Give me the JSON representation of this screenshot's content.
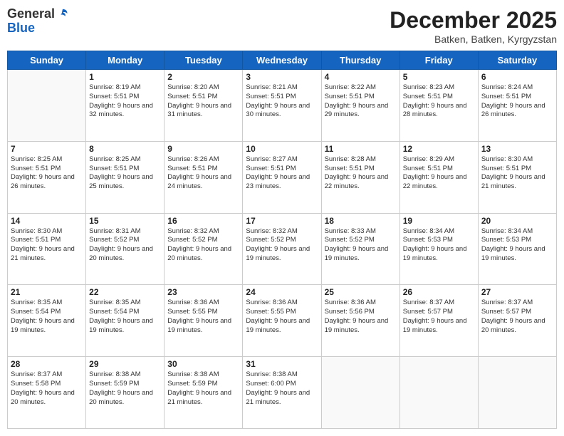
{
  "header": {
    "logo_general": "General",
    "logo_blue": "Blue",
    "month": "December 2025",
    "location": "Batken, Batken, Kyrgyzstan"
  },
  "days_of_week": [
    "Sunday",
    "Monday",
    "Tuesday",
    "Wednesday",
    "Thursday",
    "Friday",
    "Saturday"
  ],
  "weeks": [
    [
      {
        "day": "",
        "sunrise": "",
        "sunset": "",
        "daylight": ""
      },
      {
        "day": "1",
        "sunrise": "Sunrise: 8:19 AM",
        "sunset": "Sunset: 5:51 PM",
        "daylight": "Daylight: 9 hours and 32 minutes."
      },
      {
        "day": "2",
        "sunrise": "Sunrise: 8:20 AM",
        "sunset": "Sunset: 5:51 PM",
        "daylight": "Daylight: 9 hours and 31 minutes."
      },
      {
        "day": "3",
        "sunrise": "Sunrise: 8:21 AM",
        "sunset": "Sunset: 5:51 PM",
        "daylight": "Daylight: 9 hours and 30 minutes."
      },
      {
        "day": "4",
        "sunrise": "Sunrise: 8:22 AM",
        "sunset": "Sunset: 5:51 PM",
        "daylight": "Daylight: 9 hours and 29 minutes."
      },
      {
        "day": "5",
        "sunrise": "Sunrise: 8:23 AM",
        "sunset": "Sunset: 5:51 PM",
        "daylight": "Daylight: 9 hours and 28 minutes."
      },
      {
        "day": "6",
        "sunrise": "Sunrise: 8:24 AM",
        "sunset": "Sunset: 5:51 PM",
        "daylight": "Daylight: 9 hours and 26 minutes."
      }
    ],
    [
      {
        "day": "7",
        "sunrise": "Sunrise: 8:25 AM",
        "sunset": "Sunset: 5:51 PM",
        "daylight": "Daylight: 9 hours and 26 minutes."
      },
      {
        "day": "8",
        "sunrise": "Sunrise: 8:25 AM",
        "sunset": "Sunset: 5:51 PM",
        "daylight": "Daylight: 9 hours and 25 minutes."
      },
      {
        "day": "9",
        "sunrise": "Sunrise: 8:26 AM",
        "sunset": "Sunset: 5:51 PM",
        "daylight": "Daylight: 9 hours and 24 minutes."
      },
      {
        "day": "10",
        "sunrise": "Sunrise: 8:27 AM",
        "sunset": "Sunset: 5:51 PM",
        "daylight": "Daylight: 9 hours and 23 minutes."
      },
      {
        "day": "11",
        "sunrise": "Sunrise: 8:28 AM",
        "sunset": "Sunset: 5:51 PM",
        "daylight": "Daylight: 9 hours and 22 minutes."
      },
      {
        "day": "12",
        "sunrise": "Sunrise: 8:29 AM",
        "sunset": "Sunset: 5:51 PM",
        "daylight": "Daylight: 9 hours and 22 minutes."
      },
      {
        "day": "13",
        "sunrise": "Sunrise: 8:30 AM",
        "sunset": "Sunset: 5:51 PM",
        "daylight": "Daylight: 9 hours and 21 minutes."
      }
    ],
    [
      {
        "day": "14",
        "sunrise": "Sunrise: 8:30 AM",
        "sunset": "Sunset: 5:51 PM",
        "daylight": "Daylight: 9 hours and 21 minutes."
      },
      {
        "day": "15",
        "sunrise": "Sunrise: 8:31 AM",
        "sunset": "Sunset: 5:52 PM",
        "daylight": "Daylight: 9 hours and 20 minutes."
      },
      {
        "day": "16",
        "sunrise": "Sunrise: 8:32 AM",
        "sunset": "Sunset: 5:52 PM",
        "daylight": "Daylight: 9 hours and 20 minutes."
      },
      {
        "day": "17",
        "sunrise": "Sunrise: 8:32 AM",
        "sunset": "Sunset: 5:52 PM",
        "daylight": "Daylight: 9 hours and 19 minutes."
      },
      {
        "day": "18",
        "sunrise": "Sunrise: 8:33 AM",
        "sunset": "Sunset: 5:52 PM",
        "daylight": "Daylight: 9 hours and 19 minutes."
      },
      {
        "day": "19",
        "sunrise": "Sunrise: 8:34 AM",
        "sunset": "Sunset: 5:53 PM",
        "daylight": "Daylight: 9 hours and 19 minutes."
      },
      {
        "day": "20",
        "sunrise": "Sunrise: 8:34 AM",
        "sunset": "Sunset: 5:53 PM",
        "daylight": "Daylight: 9 hours and 19 minutes."
      }
    ],
    [
      {
        "day": "21",
        "sunrise": "Sunrise: 8:35 AM",
        "sunset": "Sunset: 5:54 PM",
        "daylight": "Daylight: 9 hours and 19 minutes."
      },
      {
        "day": "22",
        "sunrise": "Sunrise: 8:35 AM",
        "sunset": "Sunset: 5:54 PM",
        "daylight": "Daylight: 9 hours and 19 minutes."
      },
      {
        "day": "23",
        "sunrise": "Sunrise: 8:36 AM",
        "sunset": "Sunset: 5:55 PM",
        "daylight": "Daylight: 9 hours and 19 minutes."
      },
      {
        "day": "24",
        "sunrise": "Sunrise: 8:36 AM",
        "sunset": "Sunset: 5:55 PM",
        "daylight": "Daylight: 9 hours and 19 minutes."
      },
      {
        "day": "25",
        "sunrise": "Sunrise: 8:36 AM",
        "sunset": "Sunset: 5:56 PM",
        "daylight": "Daylight: 9 hours and 19 minutes."
      },
      {
        "day": "26",
        "sunrise": "Sunrise: 8:37 AM",
        "sunset": "Sunset: 5:57 PM",
        "daylight": "Daylight: 9 hours and 19 minutes."
      },
      {
        "day": "27",
        "sunrise": "Sunrise: 8:37 AM",
        "sunset": "Sunset: 5:57 PM",
        "daylight": "Daylight: 9 hours and 20 minutes."
      }
    ],
    [
      {
        "day": "28",
        "sunrise": "Sunrise: 8:37 AM",
        "sunset": "Sunset: 5:58 PM",
        "daylight": "Daylight: 9 hours and 20 minutes."
      },
      {
        "day": "29",
        "sunrise": "Sunrise: 8:38 AM",
        "sunset": "Sunset: 5:59 PM",
        "daylight": "Daylight: 9 hours and 20 minutes."
      },
      {
        "day": "30",
        "sunrise": "Sunrise: 8:38 AM",
        "sunset": "Sunset: 5:59 PM",
        "daylight": "Daylight: 9 hours and 21 minutes."
      },
      {
        "day": "31",
        "sunrise": "Sunrise: 8:38 AM",
        "sunset": "Sunset: 6:00 PM",
        "daylight": "Daylight: 9 hours and 21 minutes."
      },
      {
        "day": "",
        "sunrise": "",
        "sunset": "",
        "daylight": ""
      },
      {
        "day": "",
        "sunrise": "",
        "sunset": "",
        "daylight": ""
      },
      {
        "day": "",
        "sunrise": "",
        "sunset": "",
        "daylight": ""
      }
    ]
  ]
}
